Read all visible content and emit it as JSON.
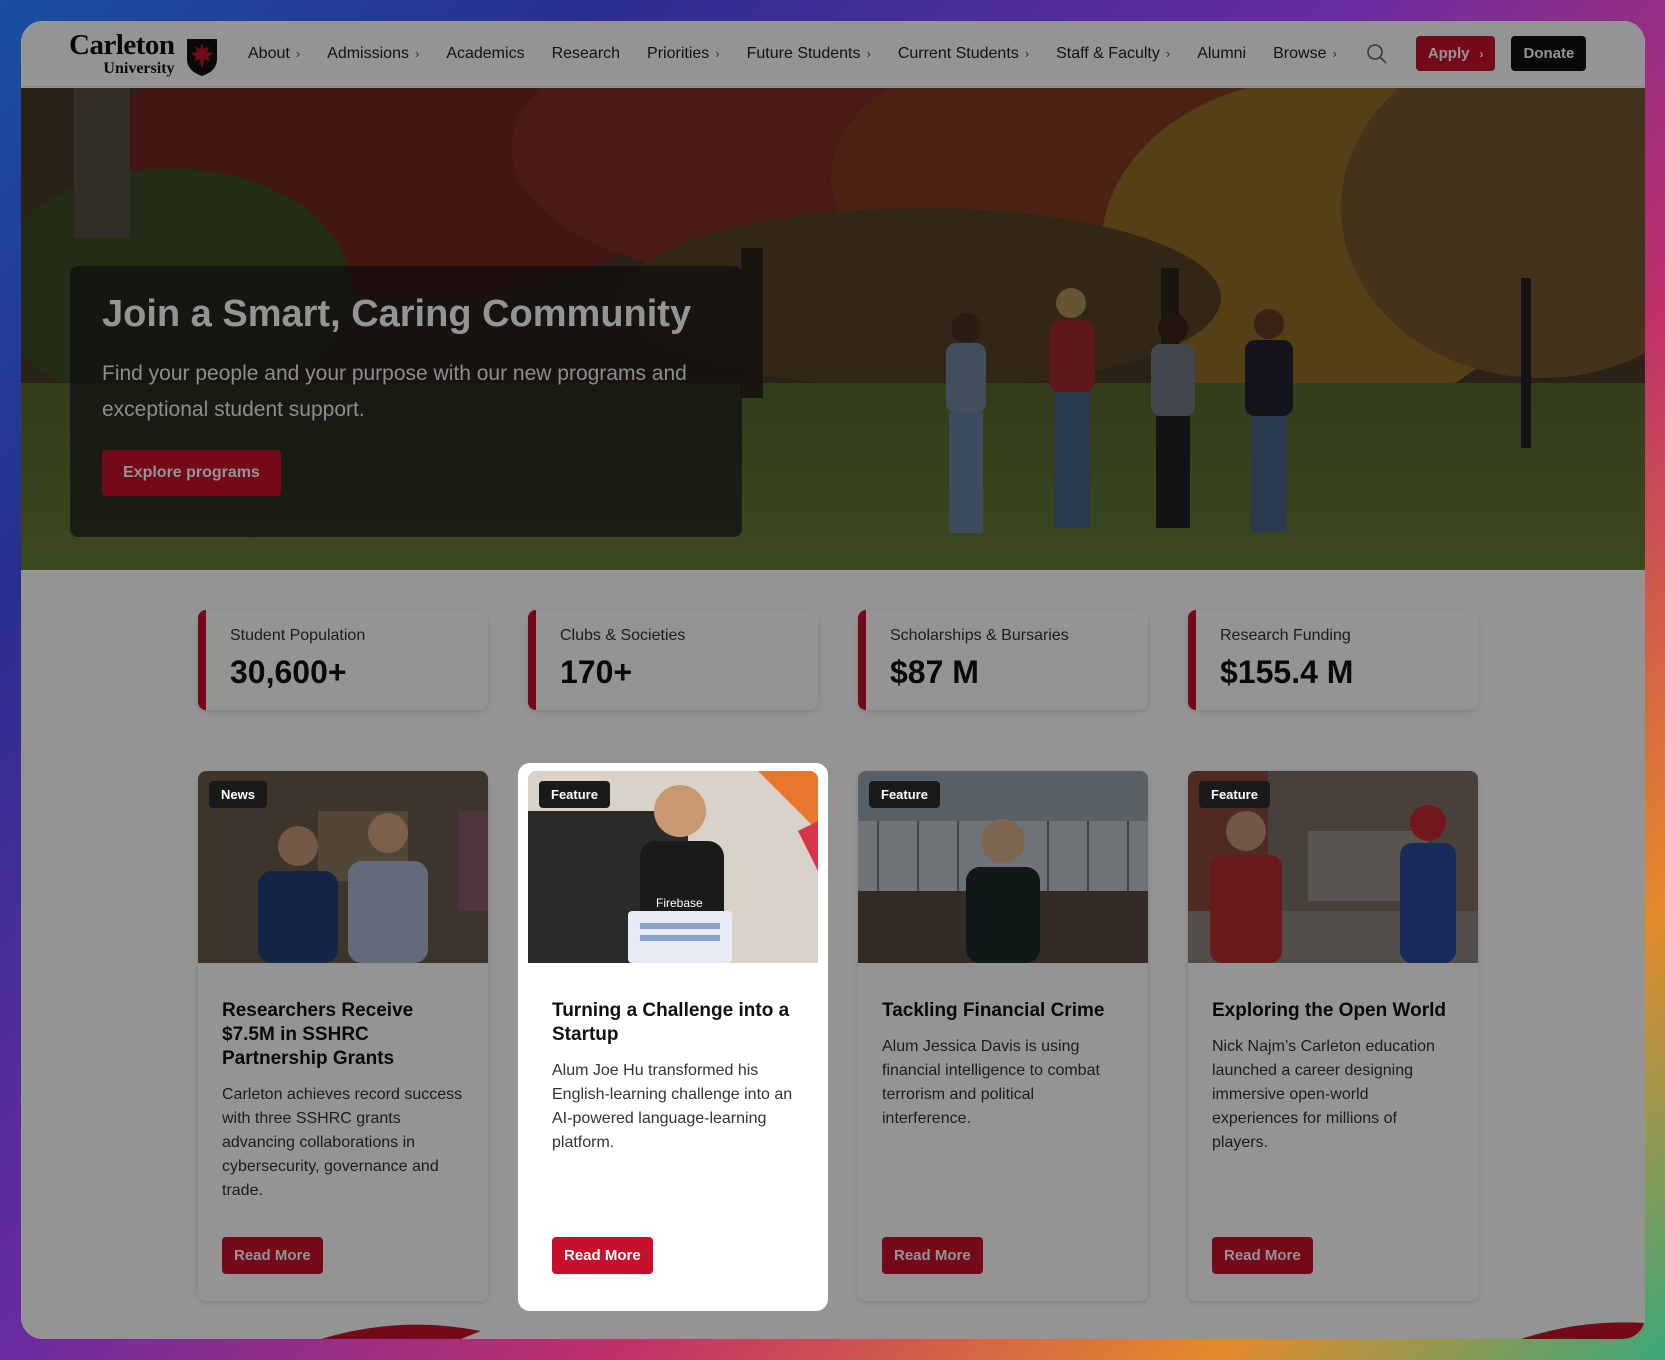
{
  "header": {
    "logo_name": "Carleton",
    "logo_sub": "University",
    "nav": [
      {
        "label": "About",
        "chevron": true
      },
      {
        "label": "Admissions",
        "chevron": true
      },
      {
        "label": "Academics",
        "chevron": false
      },
      {
        "label": "Research",
        "chevron": false
      },
      {
        "label": "Priorities",
        "chevron": true
      },
      {
        "label": "Future Students",
        "chevron": true
      },
      {
        "label": "Current Students",
        "chevron": true
      },
      {
        "label": "Staff & Faculty",
        "chevron": true
      },
      {
        "label": "Alumni",
        "chevron": false
      },
      {
        "label": "Browse",
        "chevron": true
      }
    ],
    "chevron_glyph": "›",
    "search_icon": "search-icon",
    "apply_label": "Apply",
    "donate_label": "Donate"
  },
  "hero": {
    "title": "Join a Smart, Caring Community",
    "text": "Find your people and your purpose with our new programs and exceptional student support.",
    "button": "Explore programs"
  },
  "stats": [
    {
      "label": "Student Population",
      "value": "30,600+"
    },
    {
      "label": "Clubs & Societies",
      "value": "170+"
    },
    {
      "label": "Scholarships & Bursaries",
      "value": "$87 M"
    },
    {
      "label": "Research Funding",
      "value": "$155.4 M"
    }
  ],
  "cards": [
    {
      "badge": "News",
      "title": "Researchers Receive $7.5M in SSHRC Partnership Grants",
      "text": "Carleton achieves record success with three SSHRC grants advancing collaborations in cybersecurity, governance and trade.",
      "button": "Read More"
    },
    {
      "badge": "Feature",
      "title": "Turning a Challenge into a Startup",
      "text": "Alum Joe Hu transformed his English-learning challenge into an AI-powered language-learning platform.",
      "button": "Read More",
      "shirt_text": "Firebase"
    },
    {
      "badge": "Feature",
      "title": "Tackling Financial Crime",
      "text": "Alum Jessica Davis is using financial intelligence to combat terrorism and political interference.",
      "button": "Read More"
    },
    {
      "badge": "Feature",
      "title": "Exploring the Open World",
      "text": "Nick Najm’s Carleton education launched a career designing immersive open-world experiences for millions of players.",
      "button": "Read More"
    }
  ],
  "colors": {
    "brand_red": "#c8102e",
    "dark": "#111111"
  }
}
